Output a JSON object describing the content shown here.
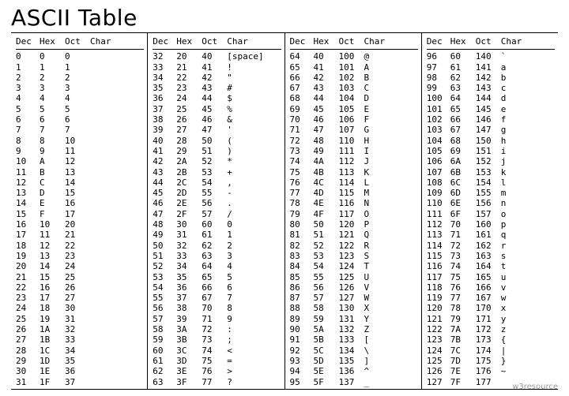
{
  "title": "ASCII Table",
  "headers": [
    "Dec",
    "Hex",
    "Oct",
    "Char"
  ],
  "watermark": "w3resource",
  "chart_data": {
    "type": "table",
    "title": "ASCII Table",
    "columns": [
      "Dec",
      "Hex",
      "Oct",
      "Char"
    ],
    "rows": [
      {
        "dec": 0,
        "hex": "0",
        "oct": "0",
        "char": ""
      },
      {
        "dec": 1,
        "hex": "1",
        "oct": "1",
        "char": ""
      },
      {
        "dec": 2,
        "hex": "2",
        "oct": "2",
        "char": ""
      },
      {
        "dec": 3,
        "hex": "3",
        "oct": "3",
        "char": ""
      },
      {
        "dec": 4,
        "hex": "4",
        "oct": "4",
        "char": ""
      },
      {
        "dec": 5,
        "hex": "5",
        "oct": "5",
        "char": ""
      },
      {
        "dec": 6,
        "hex": "6",
        "oct": "6",
        "char": ""
      },
      {
        "dec": 7,
        "hex": "7",
        "oct": "7",
        "char": ""
      },
      {
        "dec": 8,
        "hex": "8",
        "oct": "10",
        "char": ""
      },
      {
        "dec": 9,
        "hex": "9",
        "oct": "11",
        "char": ""
      },
      {
        "dec": 10,
        "hex": "A",
        "oct": "12",
        "char": ""
      },
      {
        "dec": 11,
        "hex": "B",
        "oct": "13",
        "char": ""
      },
      {
        "dec": 12,
        "hex": "C",
        "oct": "14",
        "char": ""
      },
      {
        "dec": 13,
        "hex": "D",
        "oct": "15",
        "char": ""
      },
      {
        "dec": 14,
        "hex": "E",
        "oct": "16",
        "char": ""
      },
      {
        "dec": 15,
        "hex": "F",
        "oct": "17",
        "char": ""
      },
      {
        "dec": 16,
        "hex": "10",
        "oct": "20",
        "char": ""
      },
      {
        "dec": 17,
        "hex": "11",
        "oct": "21",
        "char": ""
      },
      {
        "dec": 18,
        "hex": "12",
        "oct": "22",
        "char": ""
      },
      {
        "dec": 19,
        "hex": "13",
        "oct": "23",
        "char": ""
      },
      {
        "dec": 20,
        "hex": "14",
        "oct": "24",
        "char": ""
      },
      {
        "dec": 21,
        "hex": "15",
        "oct": "25",
        "char": ""
      },
      {
        "dec": 22,
        "hex": "16",
        "oct": "26",
        "char": ""
      },
      {
        "dec": 23,
        "hex": "17",
        "oct": "27",
        "char": ""
      },
      {
        "dec": 24,
        "hex": "18",
        "oct": "30",
        "char": ""
      },
      {
        "dec": 25,
        "hex": "19",
        "oct": "31",
        "char": ""
      },
      {
        "dec": 26,
        "hex": "1A",
        "oct": "32",
        "char": ""
      },
      {
        "dec": 27,
        "hex": "1B",
        "oct": "33",
        "char": ""
      },
      {
        "dec": 28,
        "hex": "1C",
        "oct": "34",
        "char": ""
      },
      {
        "dec": 29,
        "hex": "1D",
        "oct": "35",
        "char": ""
      },
      {
        "dec": 30,
        "hex": "1E",
        "oct": "36",
        "char": ""
      },
      {
        "dec": 31,
        "hex": "1F",
        "oct": "37",
        "char": ""
      },
      {
        "dec": 32,
        "hex": "20",
        "oct": "40",
        "char": "[space]"
      },
      {
        "dec": 33,
        "hex": "21",
        "oct": "41",
        "char": "!"
      },
      {
        "dec": 34,
        "hex": "22",
        "oct": "42",
        "char": "\""
      },
      {
        "dec": 35,
        "hex": "23",
        "oct": "43",
        "char": "#"
      },
      {
        "dec": 36,
        "hex": "24",
        "oct": "44",
        "char": "$"
      },
      {
        "dec": 37,
        "hex": "25",
        "oct": "45",
        "char": "%"
      },
      {
        "dec": 38,
        "hex": "26",
        "oct": "46",
        "char": "&"
      },
      {
        "dec": 39,
        "hex": "27",
        "oct": "47",
        "char": "'"
      },
      {
        "dec": 40,
        "hex": "28",
        "oct": "50",
        "char": "("
      },
      {
        "dec": 41,
        "hex": "29",
        "oct": "51",
        "char": ")"
      },
      {
        "dec": 42,
        "hex": "2A",
        "oct": "52",
        "char": "*"
      },
      {
        "dec": 43,
        "hex": "2B",
        "oct": "53",
        "char": "+"
      },
      {
        "dec": 44,
        "hex": "2C",
        "oct": "54",
        "char": ","
      },
      {
        "dec": 45,
        "hex": "2D",
        "oct": "55",
        "char": "-"
      },
      {
        "dec": 46,
        "hex": "2E",
        "oct": "56",
        "char": "."
      },
      {
        "dec": 47,
        "hex": "2F",
        "oct": "57",
        "char": "/"
      },
      {
        "dec": 48,
        "hex": "30",
        "oct": "60",
        "char": "0"
      },
      {
        "dec": 49,
        "hex": "31",
        "oct": "61",
        "char": "1"
      },
      {
        "dec": 50,
        "hex": "32",
        "oct": "62",
        "char": "2"
      },
      {
        "dec": 51,
        "hex": "33",
        "oct": "63",
        "char": "3"
      },
      {
        "dec": 52,
        "hex": "34",
        "oct": "64",
        "char": "4"
      },
      {
        "dec": 53,
        "hex": "35",
        "oct": "65",
        "char": "5"
      },
      {
        "dec": 54,
        "hex": "36",
        "oct": "66",
        "char": "6"
      },
      {
        "dec": 55,
        "hex": "37",
        "oct": "67",
        "char": "7"
      },
      {
        "dec": 56,
        "hex": "38",
        "oct": "70",
        "char": "8"
      },
      {
        "dec": 57,
        "hex": "39",
        "oct": "71",
        "char": "9"
      },
      {
        "dec": 58,
        "hex": "3A",
        "oct": "72",
        "char": ":"
      },
      {
        "dec": 59,
        "hex": "3B",
        "oct": "73",
        "char": ";"
      },
      {
        "dec": 60,
        "hex": "3C",
        "oct": "74",
        "char": "<"
      },
      {
        "dec": 61,
        "hex": "3D",
        "oct": "75",
        "char": "="
      },
      {
        "dec": 62,
        "hex": "3E",
        "oct": "76",
        "char": ">"
      },
      {
        "dec": 63,
        "hex": "3F",
        "oct": "77",
        "char": "?"
      },
      {
        "dec": 64,
        "hex": "40",
        "oct": "100",
        "char": "@"
      },
      {
        "dec": 65,
        "hex": "41",
        "oct": "101",
        "char": "A"
      },
      {
        "dec": 66,
        "hex": "42",
        "oct": "102",
        "char": "B"
      },
      {
        "dec": 67,
        "hex": "43",
        "oct": "103",
        "char": "C"
      },
      {
        "dec": 68,
        "hex": "44",
        "oct": "104",
        "char": "D"
      },
      {
        "dec": 69,
        "hex": "45",
        "oct": "105",
        "char": "E"
      },
      {
        "dec": 70,
        "hex": "46",
        "oct": "106",
        "char": "F"
      },
      {
        "dec": 71,
        "hex": "47",
        "oct": "107",
        "char": "G"
      },
      {
        "dec": 72,
        "hex": "48",
        "oct": "110",
        "char": "H"
      },
      {
        "dec": 73,
        "hex": "49",
        "oct": "111",
        "char": "I"
      },
      {
        "dec": 74,
        "hex": "4A",
        "oct": "112",
        "char": "J"
      },
      {
        "dec": 75,
        "hex": "4B",
        "oct": "113",
        "char": "K"
      },
      {
        "dec": 76,
        "hex": "4C",
        "oct": "114",
        "char": "L"
      },
      {
        "dec": 77,
        "hex": "4D",
        "oct": "115",
        "char": "M"
      },
      {
        "dec": 78,
        "hex": "4E",
        "oct": "116",
        "char": "N"
      },
      {
        "dec": 79,
        "hex": "4F",
        "oct": "117",
        "char": "O"
      },
      {
        "dec": 80,
        "hex": "50",
        "oct": "120",
        "char": "P"
      },
      {
        "dec": 81,
        "hex": "51",
        "oct": "121",
        "char": "Q"
      },
      {
        "dec": 82,
        "hex": "52",
        "oct": "122",
        "char": "R"
      },
      {
        "dec": 83,
        "hex": "53",
        "oct": "123",
        "char": "S"
      },
      {
        "dec": 84,
        "hex": "54",
        "oct": "124",
        "char": "T"
      },
      {
        "dec": 85,
        "hex": "55",
        "oct": "125",
        "char": "U"
      },
      {
        "dec": 86,
        "hex": "56",
        "oct": "126",
        "char": "V"
      },
      {
        "dec": 87,
        "hex": "57",
        "oct": "127",
        "char": "W"
      },
      {
        "dec": 88,
        "hex": "58",
        "oct": "130",
        "char": "X"
      },
      {
        "dec": 89,
        "hex": "59",
        "oct": "131",
        "char": "Y"
      },
      {
        "dec": 90,
        "hex": "5A",
        "oct": "132",
        "char": "Z"
      },
      {
        "dec": 91,
        "hex": "5B",
        "oct": "133",
        "char": "["
      },
      {
        "dec": 92,
        "hex": "5C",
        "oct": "134",
        "char": "\\"
      },
      {
        "dec": 93,
        "hex": "5D",
        "oct": "135",
        "char": "]"
      },
      {
        "dec": 94,
        "hex": "5E",
        "oct": "136",
        "char": "^"
      },
      {
        "dec": 95,
        "hex": "5F",
        "oct": "137",
        "char": "_"
      },
      {
        "dec": 96,
        "hex": "60",
        "oct": "140",
        "char": "`"
      },
      {
        "dec": 97,
        "hex": "61",
        "oct": "141",
        "char": "a"
      },
      {
        "dec": 98,
        "hex": "62",
        "oct": "142",
        "char": "b"
      },
      {
        "dec": 99,
        "hex": "63",
        "oct": "143",
        "char": "c"
      },
      {
        "dec": 100,
        "hex": "64",
        "oct": "144",
        "char": "d"
      },
      {
        "dec": 101,
        "hex": "65",
        "oct": "145",
        "char": "e"
      },
      {
        "dec": 102,
        "hex": "66",
        "oct": "146",
        "char": "f"
      },
      {
        "dec": 103,
        "hex": "67",
        "oct": "147",
        "char": "g"
      },
      {
        "dec": 104,
        "hex": "68",
        "oct": "150",
        "char": "h"
      },
      {
        "dec": 105,
        "hex": "69",
        "oct": "151",
        "char": "i"
      },
      {
        "dec": 106,
        "hex": "6A",
        "oct": "152",
        "char": "j"
      },
      {
        "dec": 107,
        "hex": "6B",
        "oct": "153",
        "char": "k"
      },
      {
        "dec": 108,
        "hex": "6C",
        "oct": "154",
        "char": "l"
      },
      {
        "dec": 109,
        "hex": "6D",
        "oct": "155",
        "char": "m"
      },
      {
        "dec": 110,
        "hex": "6E",
        "oct": "156",
        "char": "n"
      },
      {
        "dec": 111,
        "hex": "6F",
        "oct": "157",
        "char": "o"
      },
      {
        "dec": 112,
        "hex": "70",
        "oct": "160",
        "char": "p"
      },
      {
        "dec": 113,
        "hex": "71",
        "oct": "161",
        "char": "q"
      },
      {
        "dec": 114,
        "hex": "72",
        "oct": "162",
        "char": "r"
      },
      {
        "dec": 115,
        "hex": "73",
        "oct": "163",
        "char": "s"
      },
      {
        "dec": 116,
        "hex": "74",
        "oct": "164",
        "char": "t"
      },
      {
        "dec": 117,
        "hex": "75",
        "oct": "165",
        "char": "u"
      },
      {
        "dec": 118,
        "hex": "76",
        "oct": "166",
        "char": "v"
      },
      {
        "dec": 119,
        "hex": "77",
        "oct": "167",
        "char": "w"
      },
      {
        "dec": 120,
        "hex": "78",
        "oct": "170",
        "char": "x"
      },
      {
        "dec": 121,
        "hex": "79",
        "oct": "171",
        "char": "y"
      },
      {
        "dec": 122,
        "hex": "7A",
        "oct": "172",
        "char": "z"
      },
      {
        "dec": 123,
        "hex": "7B",
        "oct": "173",
        "char": "{"
      },
      {
        "dec": 124,
        "hex": "7C",
        "oct": "174",
        "char": "|"
      },
      {
        "dec": 125,
        "hex": "7D",
        "oct": "175",
        "char": "}"
      },
      {
        "dec": 126,
        "hex": "7E",
        "oct": "176",
        "char": "~"
      },
      {
        "dec": 127,
        "hex": "7F",
        "oct": "177",
        "char": ""
      }
    ]
  }
}
